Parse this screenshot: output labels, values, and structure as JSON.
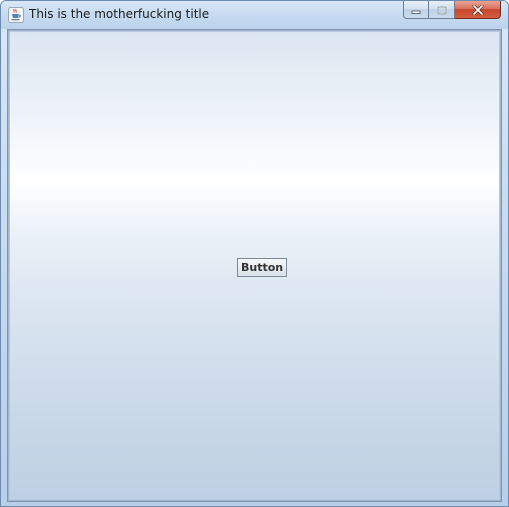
{
  "window": {
    "title": "This is the motherfucking title",
    "app_icon": "java-coffee-cup-icon",
    "caption_buttons": {
      "minimize_icon": "minimize-icon",
      "maximize_icon": "maximize-icon",
      "close_icon": "close-icon"
    }
  },
  "content": {
    "button_label": "Button"
  },
  "colors": {
    "titlebar": "#c6dbf1",
    "close_button": "#c7462b",
    "content_top": "#dce6f1",
    "content_bottom": "#bed0e3"
  }
}
